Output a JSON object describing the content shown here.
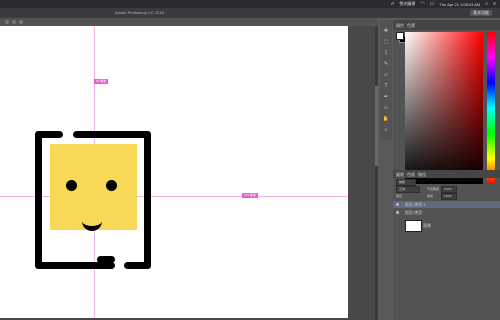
{
  "menubar": {
    "input_method": "雪夫圖標",
    "clock": "Thu Apr 21 1:08:03 AM"
  },
  "window": {
    "title": "Adobe Photoshop CC 2015",
    "workspace_button": "基本功能"
  },
  "panels": {
    "color_tab": "顏色",
    "swatches_tab": "色票",
    "layers_tabs": [
      "圖層",
      "色版",
      "路徑"
    ],
    "kind_label": "種類",
    "blend_mode": "正常",
    "opacity_label": "不透明度",
    "opacity_value": "100%",
    "lock_label": "鎖定",
    "fill_label": "填滿",
    "fill_value": "100%",
    "layer_rows": [
      "矩形 拷貝 1",
      "矩形 拷貝"
    ],
    "background_layer": "背景"
  },
  "guides": {
    "vertical_label": "94 像素",
    "horizontal_label": "170 像素"
  },
  "colors": {
    "photo_fill": "#f8d957",
    "frame": "#000000",
    "guide": "#e85cd4"
  }
}
